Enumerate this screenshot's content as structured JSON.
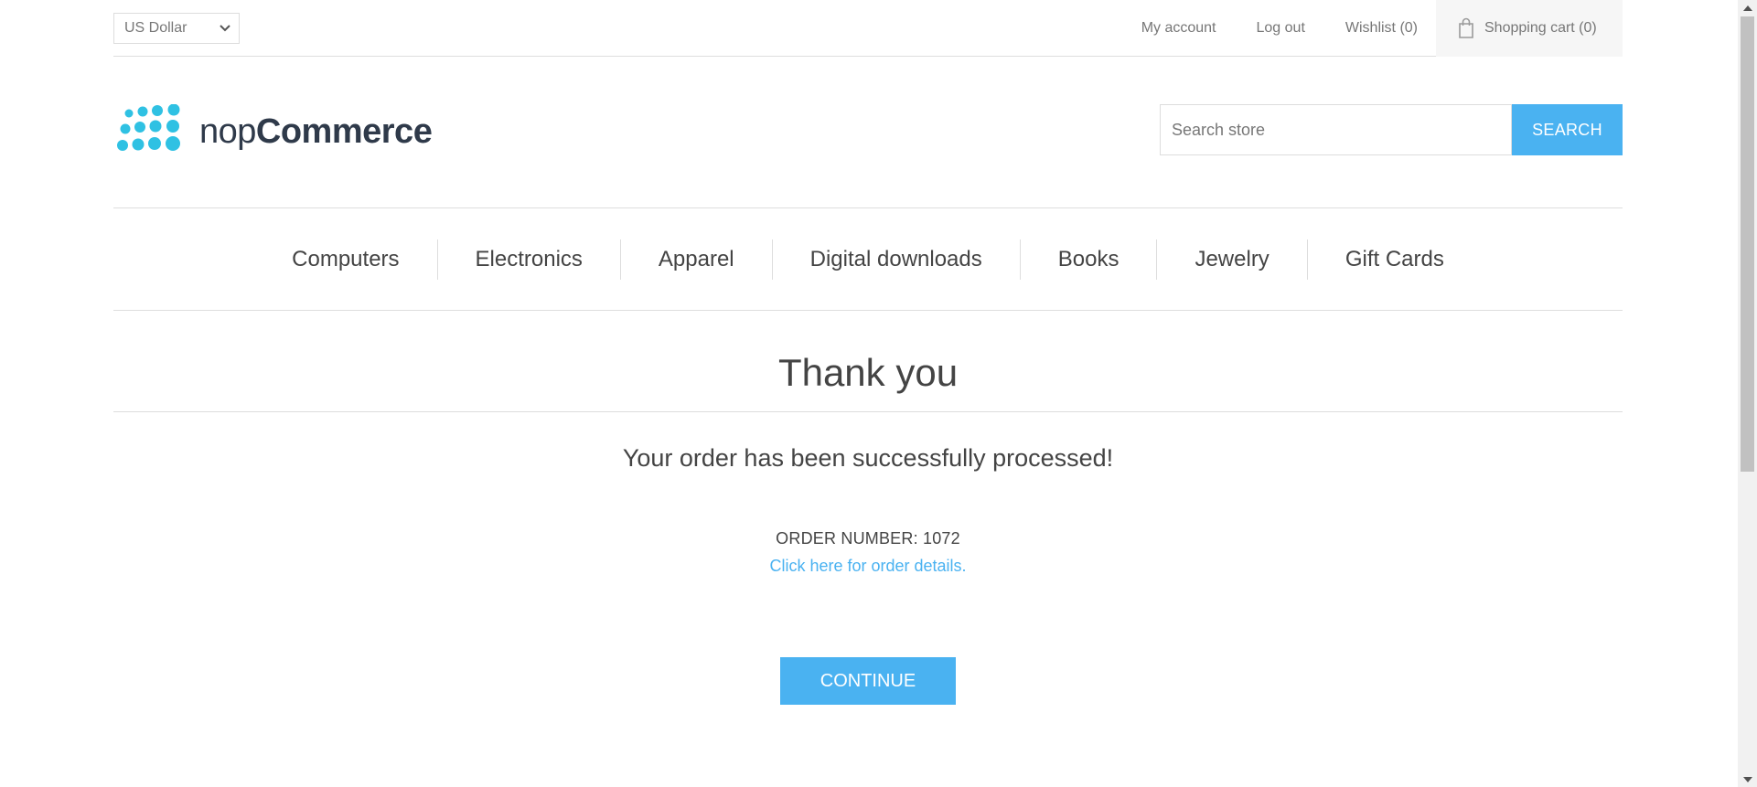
{
  "header": {
    "currency": {
      "selected": "US Dollar"
    },
    "links": {
      "my_account": "My account",
      "log_out": "Log out",
      "wishlist": "Wishlist (0)",
      "shopping_cart": "Shopping cart (0)"
    },
    "logo": {
      "text_light": "nop",
      "text_bold": "Commerce"
    },
    "search": {
      "placeholder": "Search store",
      "button_label": "SEARCH"
    }
  },
  "menu": {
    "items": [
      {
        "label": "Computers"
      },
      {
        "label": "Electronics"
      },
      {
        "label": "Apparel"
      },
      {
        "label": "Digital downloads"
      },
      {
        "label": "Books"
      },
      {
        "label": "Jewelry"
      },
      {
        "label": "Gift Cards"
      }
    ]
  },
  "main": {
    "title": "Thank you",
    "order_title": "Your order has been successfully processed!",
    "order_number": "ORDER NUMBER: 1072",
    "details_link": "Click here for order details.",
    "continue_label": "CONTINUE"
  },
  "colors": {
    "accent": "#4ab2f1",
    "logo_dots": "#2fc1e3",
    "logo_text": "#2f3a4a",
    "text": "#444444",
    "muted": "#777777",
    "border": "#dddddd"
  },
  "icons": {
    "currency_dropdown": "chevron-down-icon",
    "cart": "shopping-bag-icon",
    "logo_mark": "dot-grid-logo-icon",
    "scroll_up": "scroll-up-arrow-icon",
    "scroll_down": "scroll-down-arrow-icon"
  }
}
